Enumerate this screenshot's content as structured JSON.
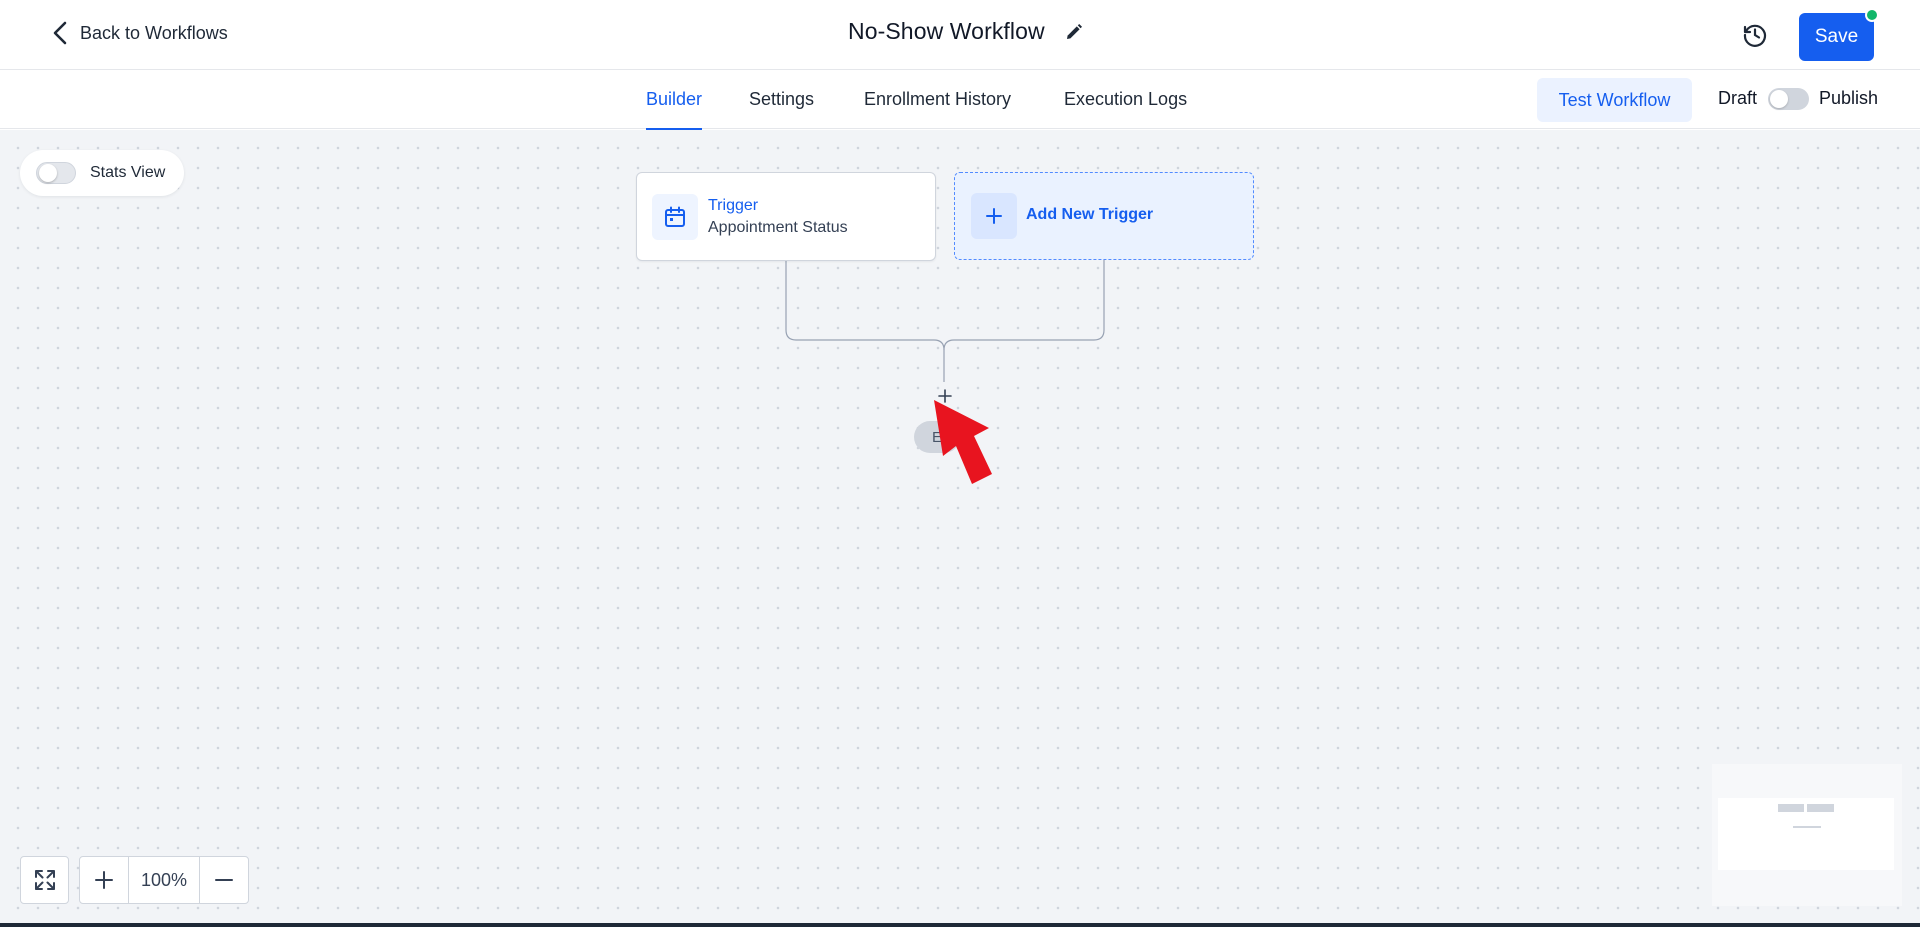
{
  "header": {
    "back_label": "Back to Workflows",
    "title": "No-Show Workflow",
    "save_label": "Save",
    "icons": {
      "back": "chevron-left-icon",
      "edit": "pencil-icon",
      "history": "history-icon"
    },
    "status_dot_color": "#12b76a"
  },
  "tabs": [
    {
      "label": "Builder",
      "active": true
    },
    {
      "label": "Settings",
      "active": false
    },
    {
      "label": "Enrollment History",
      "active": false
    },
    {
      "label": "Execution Logs",
      "active": false
    }
  ],
  "actions": {
    "test_label": "Test Workflow",
    "draft_label": "Draft",
    "publish_label": "Publish",
    "publish_on": false
  },
  "canvas": {
    "stats_view_label": "Stats View",
    "stats_view_on": false,
    "trigger_node": {
      "title": "Trigger",
      "subtitle": "Appointment Status",
      "icon": "calendar-icon"
    },
    "add_trigger_label": "Add New Trigger",
    "end_label": "E"
  },
  "controls": {
    "zoom_level": "100%"
  },
  "colors": {
    "accent": "#155eef",
    "canvas_bg": "#f2f4f7",
    "annotation_arrow": "#e8141f"
  }
}
